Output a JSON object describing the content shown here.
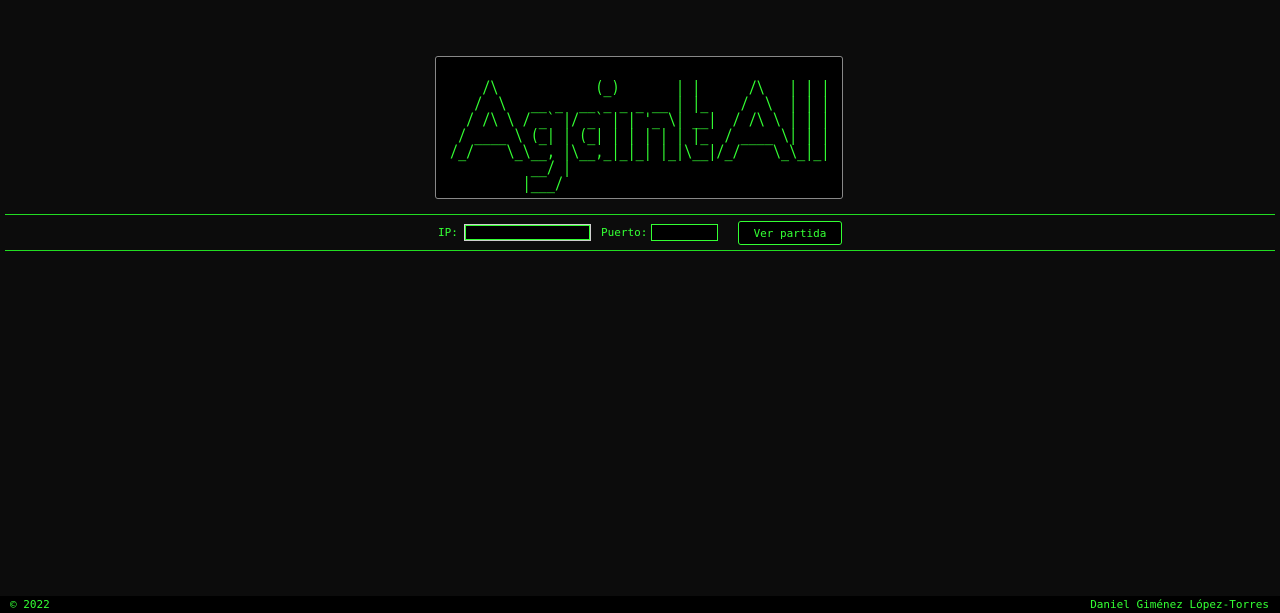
{
  "logo": {
    "ascii_lines": [
      "    /\\            (_)       | |      /\\   | | |",
      "   /  \\   __ _  __ _ _ _ __ | |_    /  \\  | | |",
      "  / /\\ \\ / _` |/ _` | | '_ \\| __|  / /\\ \\ | | |",
      " / ____ \\ (_| | (_| | | | | | |_  / ____ \\| | |",
      "/_/    \\_\\__, |\\__,_|_|_| |_|\\__|/_/    \\_\\_|_|",
      "          __/ |",
      "         |___/"
    ],
    "alt": "Against All"
  },
  "connect": {
    "ip_label": "IP:",
    "ip_value": "",
    "port_label": "Puerto:",
    "port_value": "",
    "button_label": "Ver partida"
  },
  "footer": {
    "copyright": "© 2022",
    "author": "Daniel Giménez López-Torres"
  },
  "colors": {
    "background": "#0c0c0c",
    "text": "#33ff33",
    "panel": "#000000",
    "panel_border": "#888888"
  }
}
